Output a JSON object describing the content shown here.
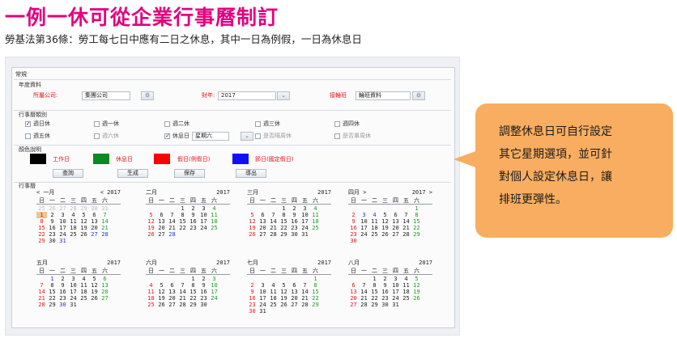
{
  "headline": "一例一休可從企業行事曆制訂",
  "subline": "勞基法第36條：勞工每七日中應有二日之休息，其中一日為例假，一日為休息日",
  "form": {
    "tab": "常規",
    "section_year": "年度資料",
    "company_label": "所屬公司:",
    "company_value": "集團公司",
    "fiscal_label": "財年:",
    "fiscal_value": "2017",
    "shift_label": "接輪班",
    "shift_value": "輪班資料",
    "section_type": "行事曆類別",
    "weekdays": [
      {
        "label": "週日休",
        "checked": true
      },
      {
        "label": "週一休",
        "checked": false
      },
      {
        "label": "週二休",
        "checked": false
      },
      {
        "label": "週三休",
        "checked": false
      },
      {
        "label": "週四休",
        "checked": false
      },
      {
        "label": "週五休",
        "checked": false
      },
      {
        "label": "週六休",
        "checked": false
      },
      {
        "label": "休息日",
        "checked": true
      },
      {
        "label": "是否隔周休",
        "checked": false
      },
      {
        "label": "是否單周休",
        "checked": false
      }
    ],
    "restday_select": "星期六",
    "section_color": "顏色說明",
    "legend": [
      {
        "label": "工作日",
        "color": "#000000",
        "text_color": "#e01818"
      },
      {
        "label": "休息日",
        "color": "#0a8a20",
        "text_color": "#e01818"
      },
      {
        "label": "假日(例假日)",
        "color": "#ff0000",
        "text_color": "#e01818"
      },
      {
        "label": "節日(國定假日)",
        "color": "#1010ff",
        "text_color": "#e01818"
      }
    ],
    "buttons": {
      "query": "查詢",
      "generate": "生成",
      "save": "保存",
      "export": "導出"
    },
    "section_calendar": "行事曆"
  },
  "calendar": {
    "weekday_headers": [
      "日",
      "一",
      "二",
      "三",
      "四",
      "五",
      "六"
    ],
    "nav": {
      "prev": "<",
      "next": ">",
      "prev_year": "<",
      "next_year": ">"
    },
    "months": [
      {
        "name": "一月",
        "year": "2017",
        "rows": [
          [
            "1",
            "2",
            "3",
            "4",
            "5",
            "6",
            "7"
          ],
          [
            "8",
            "9",
            "10",
            "11",
            "12",
            "13",
            "14"
          ],
          [
            "15",
            "16",
            "17",
            "18",
            "19",
            "20",
            "21"
          ],
          [
            "22",
            "23",
            "24",
            "25",
            "26",
            "27",
            "28"
          ],
          [
            "29",
            "30",
            "31",
            "",
            "",
            "",
            "",
            ""
          ]
        ],
        "pre": [
          "25",
          "26",
          "27",
          "28",
          "29",
          "30",
          "31"
        ],
        "blue": [
          "27",
          "28",
          "31"
        ]
      },
      {
        "name": "二月",
        "year": "2017",
        "lead": 3,
        "days": 28,
        "blue": [
          "28"
        ]
      },
      {
        "name": "三月",
        "year": "2017",
        "lead": 3,
        "days": 31,
        "blue": []
      },
      {
        "name": "四月",
        "year": "2017",
        "lead": 6,
        "days": 30,
        "blue": [
          "3",
          "4"
        ]
      },
      {
        "name": "五月",
        "year": "2017",
        "lead": 1,
        "days": 31,
        "blue": [
          "1",
          "30"
        ]
      },
      {
        "name": "六月",
        "year": "2017",
        "lead": 4,
        "days": 30,
        "blue": []
      },
      {
        "name": "七月",
        "year": "2017",
        "lead": 6,
        "days": 31,
        "blue": []
      },
      {
        "name": "八月",
        "year": "2017",
        "lead": 2,
        "days": 31,
        "blue": []
      }
    ]
  },
  "callout": {
    "lines": [
      "調整休息日可自行設定",
      "其它星期選項，並可針",
      "對個人設定休息日，讓",
      "排班更彈性。"
    ],
    "color": "#f8ad60"
  }
}
